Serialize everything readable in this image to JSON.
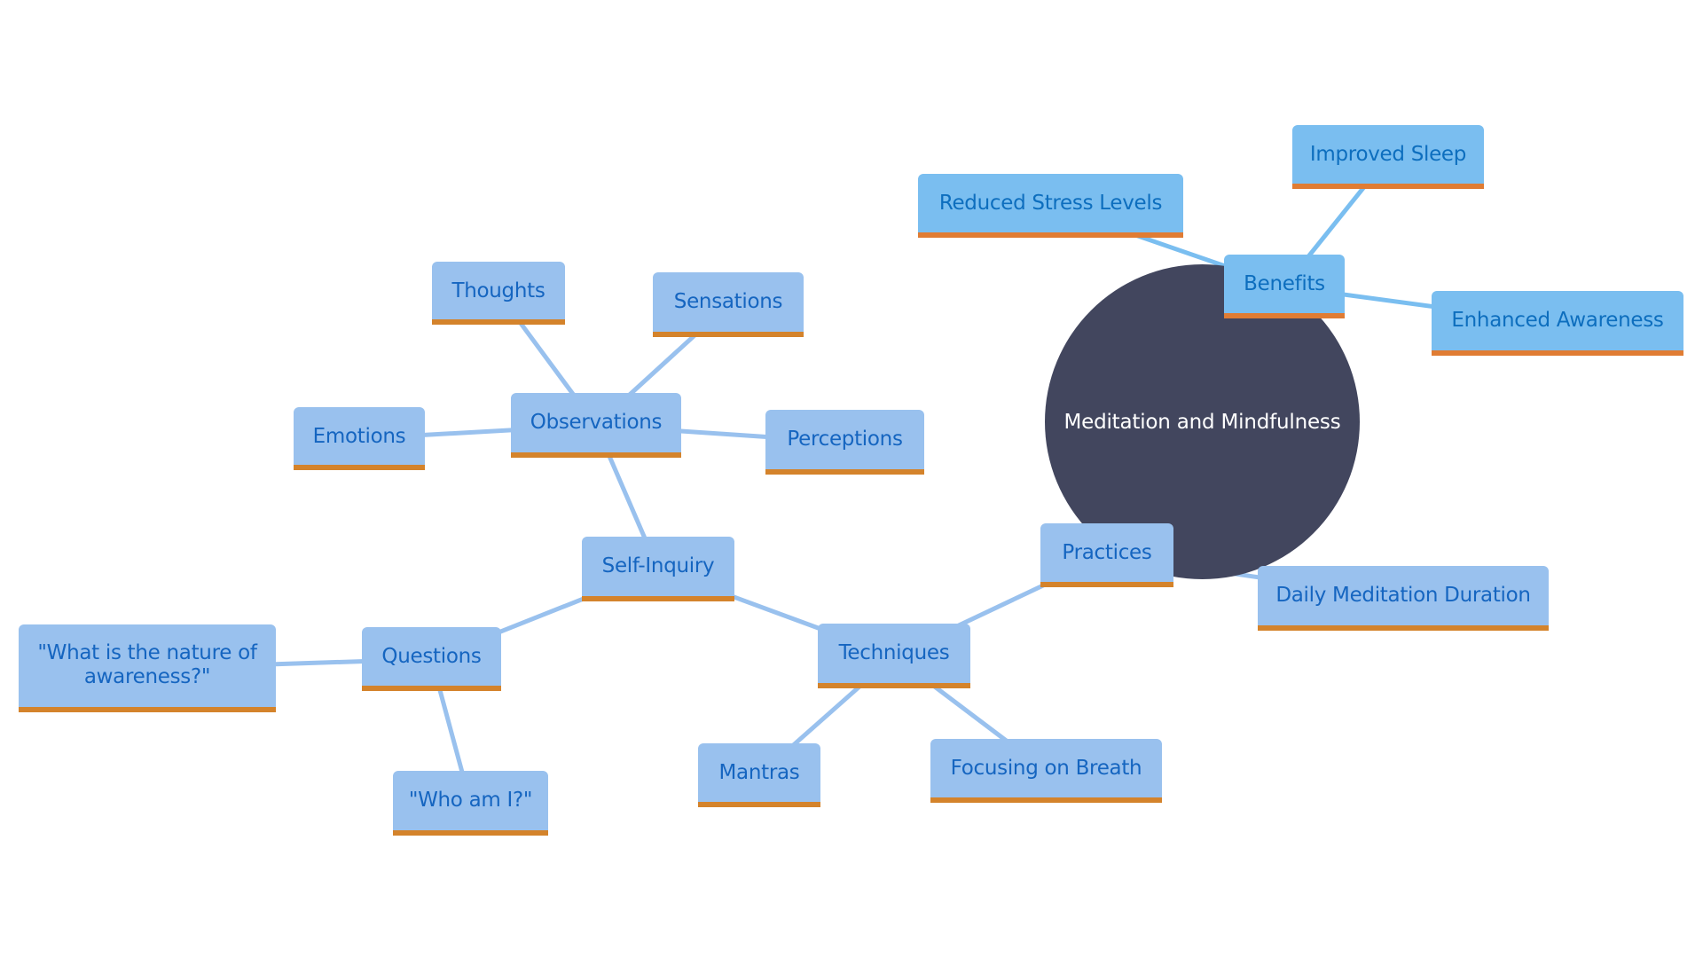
{
  "diagram": {
    "type": "mind-map",
    "root": {
      "id": "root",
      "label": "Meditation and Mindfulness",
      "color": "#42465e",
      "text_color": "#ffffff"
    },
    "styles": {
      "benefits_branch": {
        "fill": "#7abef0",
        "bar": "#e07c33",
        "text": "#0d6ebe",
        "edge": "#7abef0"
      },
      "default_branch": {
        "fill": "#99c1ee",
        "bar": "#d4832b",
        "text": "#1565c0",
        "edge": "#99c1ee"
      }
    },
    "nodes": [
      {
        "id": "benefits",
        "label": "Benefits",
        "parent": "root",
        "style": "benefits_branch"
      },
      {
        "id": "reduced-stress",
        "label": "Reduced Stress Levels",
        "parent": "benefits",
        "style": "benefits_branch"
      },
      {
        "id": "improved-sleep",
        "label": "Improved Sleep",
        "parent": "benefits",
        "style": "benefits_branch"
      },
      {
        "id": "enhanced-awareness",
        "label": "Enhanced Awareness",
        "parent": "benefits",
        "style": "benefits_branch"
      },
      {
        "id": "practices",
        "label": "Practices",
        "parent": "root",
        "style": "default_branch"
      },
      {
        "id": "daily-duration",
        "label": "Daily Meditation Duration",
        "parent": "practices",
        "style": "default_branch"
      },
      {
        "id": "techniques",
        "label": "Techniques",
        "parent": "practices",
        "style": "default_branch"
      },
      {
        "id": "mantras",
        "label": "Mantras",
        "parent": "techniques",
        "style": "default_branch"
      },
      {
        "id": "focusing-breath",
        "label": "Focusing on Breath",
        "parent": "techniques",
        "style": "default_branch"
      },
      {
        "id": "self-inquiry",
        "label": "Self-Inquiry",
        "parent": "techniques",
        "style": "default_branch"
      },
      {
        "id": "questions",
        "label": "Questions",
        "parent": "self-inquiry",
        "style": "default_branch"
      },
      {
        "id": "nature-awareness",
        "label": "\"What is the nature of\nawareness?\"",
        "parent": "questions",
        "style": "default_branch"
      },
      {
        "id": "who-am-i",
        "label": "\"Who am I?\"",
        "parent": "questions",
        "style": "default_branch"
      },
      {
        "id": "observations",
        "label": "Observations",
        "parent": "self-inquiry",
        "style": "default_branch"
      },
      {
        "id": "emotions",
        "label": "Emotions",
        "parent": "observations",
        "style": "default_branch"
      },
      {
        "id": "thoughts",
        "label": "Thoughts",
        "parent": "observations",
        "style": "default_branch"
      },
      {
        "id": "sensations",
        "label": "Sensations",
        "parent": "observations",
        "style": "default_branch"
      },
      {
        "id": "perceptions",
        "label": "Perceptions",
        "parent": "observations",
        "style": "default_branch"
      }
    ]
  }
}
